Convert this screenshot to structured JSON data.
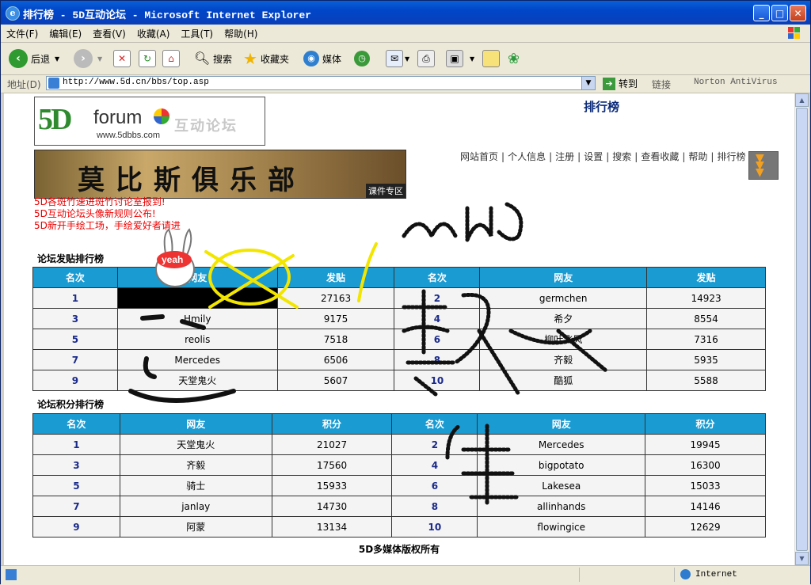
{
  "window": {
    "title": "排行榜 - 5D互动论坛 - Microsoft Internet Explorer",
    "controls": {
      "minimize": "_",
      "maximize": "□",
      "close": "✕"
    }
  },
  "menu": [
    "文件(F)",
    "编辑(E)",
    "查看(V)",
    "收藏(A)",
    "工具(T)",
    "帮助(H)"
  ],
  "toolbar": {
    "back": "后退",
    "search": "搜索",
    "favorites": "收藏夹",
    "media": "媒体"
  },
  "address": {
    "label": "地址(D)",
    "url": "http://www.5d.cn/bbs/top.asp",
    "go": "转到",
    "links": "链接",
    "norton": "Norton AntiVirus"
  },
  "page": {
    "logo_5d": "5D",
    "logo_forum": "forum",
    "logo_url": "www.5dbbs.com",
    "logo_cn": "互动论坛",
    "title": "排行榜",
    "banner_text": "莫比斯俱乐部",
    "banner_tag": "课件专区",
    "nav": [
      "网站首页",
      "个人信息",
      "注册",
      "设置",
      "搜索",
      "查看收藏",
      "帮助",
      "排行榜"
    ],
    "nav_sep": "|",
    "notices": [
      "5D各斑竹速进斑竹讨论室报到!",
      "5D互动论坛头像新规则公布!",
      "5D新开手绘工场，手绘爱好者请进"
    ],
    "posts_section": "论坛发贴排行榜",
    "posts_headers": [
      "名次",
      "网友",
      "发贴",
      "名次",
      "网友",
      "发贴"
    ],
    "posts_rows": [
      [
        "1",
        "",
        "27163",
        "2",
        "germchen",
        "14923"
      ],
      [
        "3",
        "Hmily",
        "9175",
        "4",
        "希夕",
        "8554"
      ],
      [
        "5",
        "reolis",
        "7518",
        "6",
        "柳叶飞风",
        "7316"
      ],
      [
        "7",
        "Mercedes",
        "6506",
        "8",
        "齐毅",
        "5935"
      ],
      [
        "9",
        "天堂鬼火",
        "5607",
        "10",
        "酷狐",
        "5588"
      ]
    ],
    "points_section": "论坛积分排行榜",
    "points_headers": [
      "名次",
      "网友",
      "积分",
      "名次",
      "网友",
      "积分"
    ],
    "points_rows": [
      [
        "1",
        "天堂鬼火",
        "21027",
        "2",
        "Mercedes",
        "19945"
      ],
      [
        "3",
        "齐毅",
        "17560",
        "4",
        "bigpotato",
        "16300"
      ],
      [
        "5",
        "骑士",
        "15933",
        "6",
        "Lakesea",
        "15033"
      ],
      [
        "7",
        "janlay",
        "14730",
        "8",
        "allinhands",
        "14146"
      ],
      [
        "9",
        "阿蒙",
        "13134",
        "10",
        "flowingice",
        "12629"
      ]
    ],
    "footer": "5D多媒体版权所有",
    "sticker_text": "yeah"
  },
  "status": {
    "zone": "Internet"
  }
}
